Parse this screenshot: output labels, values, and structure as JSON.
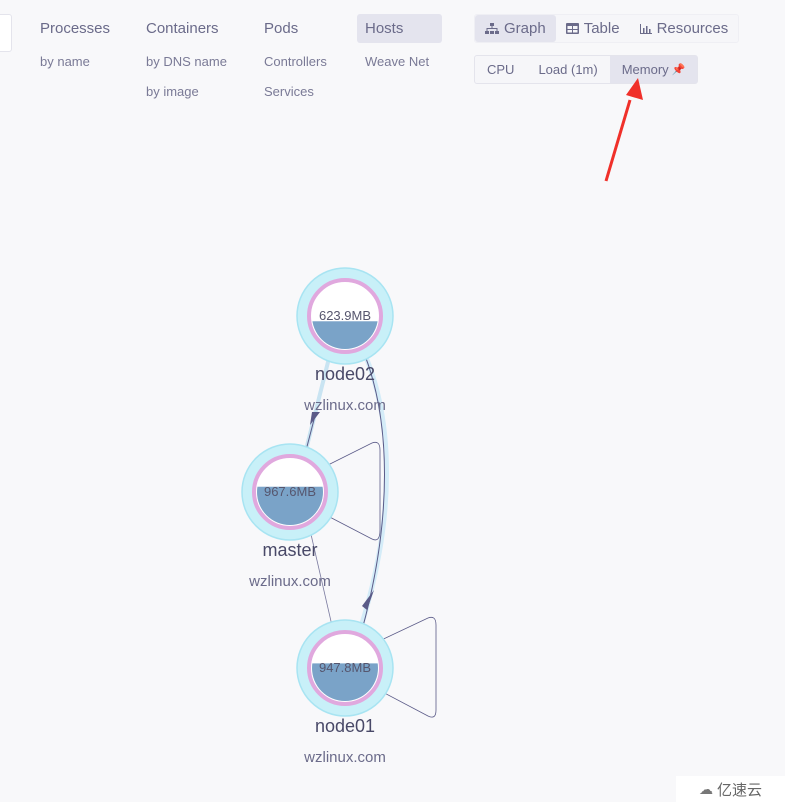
{
  "topologies": [
    {
      "label": "Processes",
      "active": false,
      "sub": [
        "by name"
      ]
    },
    {
      "label": "Containers",
      "active": false,
      "sub": [
        "by DNS name",
        "by image"
      ]
    },
    {
      "label": "Pods",
      "active": false,
      "sub": [
        "Controllers",
        "Services"
      ]
    },
    {
      "label": "Hosts",
      "active": true,
      "sub": [
        "Weave Net"
      ]
    }
  ],
  "view_modes": [
    {
      "label": "Graph",
      "icon": "graph-icon",
      "active": true
    },
    {
      "label": "Table",
      "icon": "table-icon",
      "active": false
    },
    {
      "label": "Resources",
      "icon": "resources-icon",
      "active": false
    }
  ],
  "metrics": [
    {
      "label": "CPU",
      "active": false
    },
    {
      "label": "Load (1m)",
      "active": false
    },
    {
      "label": "Memory",
      "active": true,
      "pinned": true
    }
  ],
  "nodes": [
    {
      "id": "node02",
      "label": "node02",
      "sublabel": "wzlinux.com",
      "metric": "623.9MB",
      "fill": 0.42
    },
    {
      "id": "master",
      "label": "master",
      "sublabel": "wzlinux.com",
      "metric": "967.6MB",
      "fill": 0.58
    },
    {
      "id": "node01",
      "label": "node01",
      "sublabel": "wzlinux.com",
      "metric": "947.8MB",
      "fill": 0.57
    }
  ],
  "edges": [
    {
      "from": "master",
      "to": "node02"
    },
    {
      "from": "node02",
      "to": "node01"
    },
    {
      "from": "master",
      "to": "node01"
    },
    {
      "from": "master",
      "to": "master"
    },
    {
      "from": "node01",
      "to": "node01"
    }
  ],
  "colors": {
    "accent_red": "#f0302a",
    "pin": "#f0532a",
    "node_outer": "#c8f0f8",
    "node_ring": "#e0a8de",
    "node_fill": "#7aa3c8",
    "edge": "#5b5b88"
  },
  "watermark": "亿速云"
}
